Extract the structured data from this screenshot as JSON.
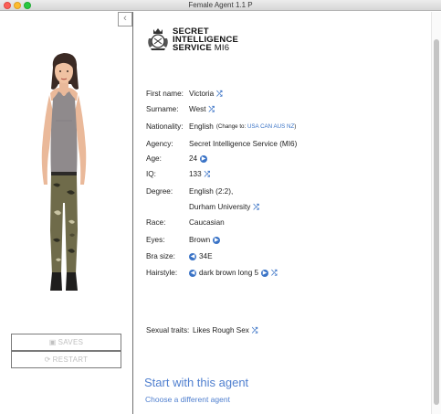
{
  "window": {
    "title": "Female Agent 1.1 P"
  },
  "left_pane": {
    "collapse_glyph": "‹",
    "save_button": {
      "icon": "▣",
      "label": "SAVES"
    },
    "restart_button": {
      "icon": "⟳",
      "label": "RESTART"
    }
  },
  "logo": {
    "line1": "SECRET",
    "line2": "INTELLIGENCE",
    "line3": "SERVICE",
    "line3_suffix": "MI6"
  },
  "profile": {
    "first_name": {
      "label": "First name:",
      "value": "Victoria"
    },
    "surname": {
      "label": "Surname:",
      "value": "West"
    },
    "nationality": {
      "label": "Nationality:",
      "value": "English",
      "change_prefix": "(Change to:",
      "options": [
        "USA",
        "CAN",
        "AUS",
        "NZ"
      ],
      "change_suffix": ")"
    },
    "agency": {
      "label": "Agency:",
      "value": "Secret Intelligence Service (MI6)"
    },
    "age": {
      "label": "Age:",
      "value": "24"
    },
    "iq": {
      "label": "IQ:",
      "value": "133"
    },
    "degree": {
      "label": "Degree:",
      "value": "English (2:2),",
      "university": "Durham University"
    },
    "race": {
      "label": "Race:",
      "value": "Caucasian"
    },
    "eyes": {
      "label": "Eyes:",
      "value": "Brown"
    },
    "bra_size": {
      "label": "Bra size:",
      "value": "34E"
    },
    "hairstyle": {
      "label": "Hairstyle:",
      "value": "dark brown long 5"
    },
    "sexual_traits": {
      "label": "Sexual traits:",
      "value": "Likes Rough Sex"
    }
  },
  "actions": {
    "start": "Start with this agent",
    "choose": "Choose a different agent"
  },
  "icons": {
    "shuffle": "shuffle-icon",
    "next": "arrow-right-circle-icon",
    "prev": "arrow-left-circle-icon"
  },
  "colors": {
    "link": "#4f7fcf",
    "accent": "#3a73c6"
  }
}
